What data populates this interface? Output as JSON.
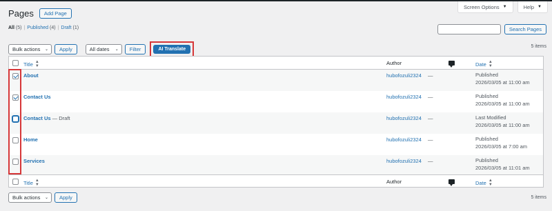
{
  "header": {
    "title": "Pages",
    "add_new": "Add Page",
    "screen_options": "Screen Options",
    "help": "Help"
  },
  "views": {
    "all": "All",
    "all_count": "(5)",
    "separator": "|",
    "published": "Published",
    "published_count": "(4)",
    "draft": "Draft",
    "draft_count": "(1)"
  },
  "search": {
    "placeholder": "",
    "button": "Search Pages"
  },
  "tablenav_top": {
    "bulk_actions": "Bulk actions",
    "apply": "Apply",
    "dates": "All dates",
    "filter": "Filter",
    "ai_translate": "AI Translate",
    "items_count": "5 items"
  },
  "tablenav_bottom": {
    "bulk_actions": "Bulk actions",
    "apply": "Apply",
    "items_count": "5 items"
  },
  "columns": {
    "title": "Title",
    "author": "Author",
    "date": "Date"
  },
  "rows": [
    {
      "title": "About",
      "state": "",
      "author": "hubofozuli2324",
      "comments": "—",
      "status": "Published",
      "date": "2026/03/05 at 11:00 am",
      "checked": true
    },
    {
      "title": "Contact Us",
      "state": "",
      "author": "hubofozuli2324",
      "comments": "—",
      "status": "Published",
      "date": "2026/03/05 at 11:00 am",
      "checked": true
    },
    {
      "title": "Contact Us",
      "state": " — Draft",
      "author": "hubofozuli2324",
      "comments": "—",
      "status": "Last Modified",
      "date": "2026/03/05 at 11:00 am",
      "checked": false
    },
    {
      "title": "Home",
      "state": "",
      "author": "hubofozuli2324",
      "comments": "—",
      "status": "Published",
      "date": "2026/03/05 at 7:00 am",
      "checked": false
    },
    {
      "title": "Services",
      "state": "",
      "author": "hubofozuli2324",
      "comments": "—",
      "status": "Published",
      "date": "2026/03/05 at 11:01 am",
      "checked": false
    }
  ],
  "colors": {
    "link": "#2271b1",
    "highlight": "#d63638",
    "background": "#f0f0f1"
  }
}
